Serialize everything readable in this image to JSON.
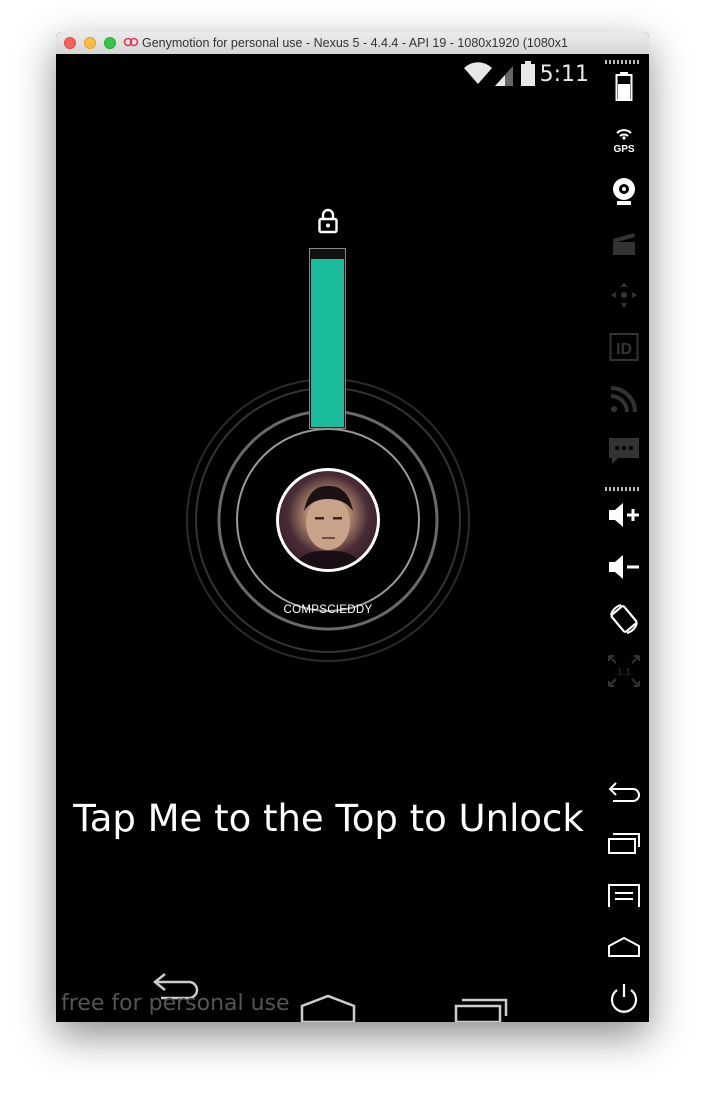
{
  "window": {
    "title": "Genymotion for personal use - Nexus 5 - 4.4.4 - API 19 - 1080x1920 (1080x1"
  },
  "status_bar": {
    "time": "5:11"
  },
  "lock_screen": {
    "unlock_progress": 0.95,
    "user_name": "COMPSCIEDDY",
    "instruction": "Tap Me to the Top to Unlock",
    "accent_color": "#1abc9c"
  },
  "watermark": "free for personal use",
  "sidebar": {
    "gps_label": "GPS",
    "id_label": "ID",
    "scale_label": "1:1"
  },
  "icons": [
    "battery-icon",
    "gps-icon",
    "webcam-icon",
    "capture-icon",
    "dpad-icon",
    "id-icon",
    "rss-icon",
    "sms-icon",
    "volume-up-icon",
    "volume-down-icon",
    "rotate-icon",
    "scale-icon",
    "back-icon",
    "recent-apps-icon",
    "menu-icon",
    "home-icon",
    "power-icon"
  ]
}
